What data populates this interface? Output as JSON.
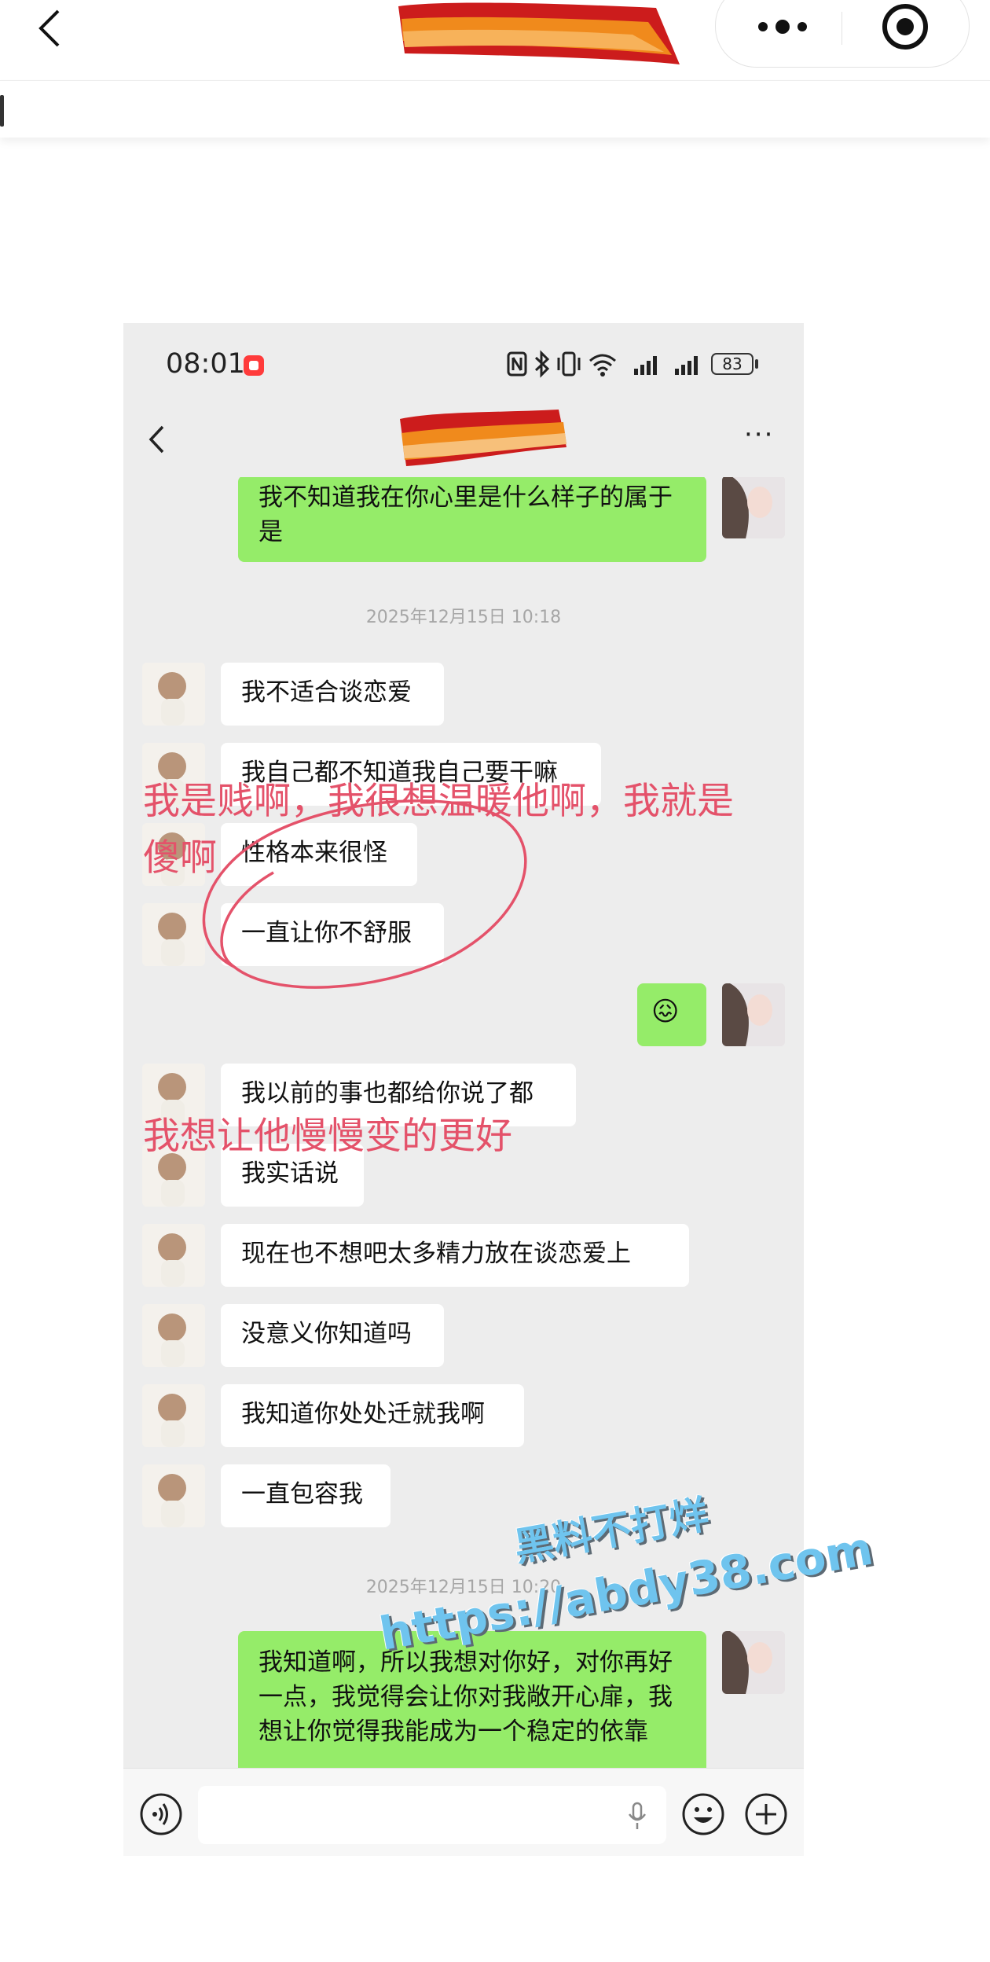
{
  "browser": {
    "back_icon": "chevron-left-icon",
    "more_icon": "more-dots-icon",
    "close_icon": "record-target-icon",
    "title_redacted": "redaction-ribbon"
  },
  "chat_screenshot": {
    "status_bar": {
      "time": "08:01",
      "battery": "83",
      "icons": [
        "nfc-icon",
        "bluetooth-icon",
        "vibrate-icon",
        "wifi-icon",
        "signal-icon",
        "signal-icon"
      ]
    },
    "nav": {
      "back_icon": "chevron-left-icon",
      "more_label": "···",
      "title_redacted": "redaction-ribbon"
    },
    "messages": [
      {
        "side": "out",
        "text": "我不知道我在你心里是什么样子的属于是"
      },
      {
        "side": "time",
        "text": "2025年12月15日 10:18"
      },
      {
        "side": "in",
        "text": "我不适合谈恋爱"
      },
      {
        "side": "in",
        "text": "我自己都不知道我自己要干嘛"
      },
      {
        "side": "in",
        "text": "性格本来很怪"
      },
      {
        "side": "in",
        "text": "一直让你不舒服"
      },
      {
        "side": "out",
        "text": "😖"
      },
      {
        "side": "in",
        "text": "我以前的事也都给你说了都"
      },
      {
        "side": "in",
        "text": "我实话说"
      },
      {
        "side": "in",
        "text": "现在也不想吧太多精力放在谈恋爱上"
      },
      {
        "side": "in",
        "text": "没意义你知道吗"
      },
      {
        "side": "in",
        "text": "我知道你处处迁就我啊"
      },
      {
        "side": "in",
        "text": "一直包容我"
      },
      {
        "side": "time",
        "text": "2025年12月15日 10:20"
      },
      {
        "side": "out",
        "text": "我知道啊，所以我想对你好，对你再好一点，我觉得会让你对我敞开心扉，我想让你觉得我能成为一个稳定的依靠"
      }
    ],
    "input_bar": {
      "voice_icon": "voice-icon",
      "mic_icon": "microphone-icon",
      "emoji_icon": "emoji-icon",
      "plus_icon": "plus-icon"
    }
  },
  "annotations": {
    "line1": "我是贱啊，我很想温暖他啊，我就是",
    "line2": "傻啊",
    "line3": "我想让他慢慢变的更好",
    "circle_color": "#e4526a"
  },
  "watermark": {
    "line1": "黑料不打烊",
    "line2": "https://abdy38.com"
  },
  "colors": {
    "outgoing_bubble": "#95ec69",
    "incoming_bubble": "#ffffff",
    "chat_background": "#ededed",
    "annotation": "#e4526a",
    "watermark": "#6fc4ee"
  }
}
